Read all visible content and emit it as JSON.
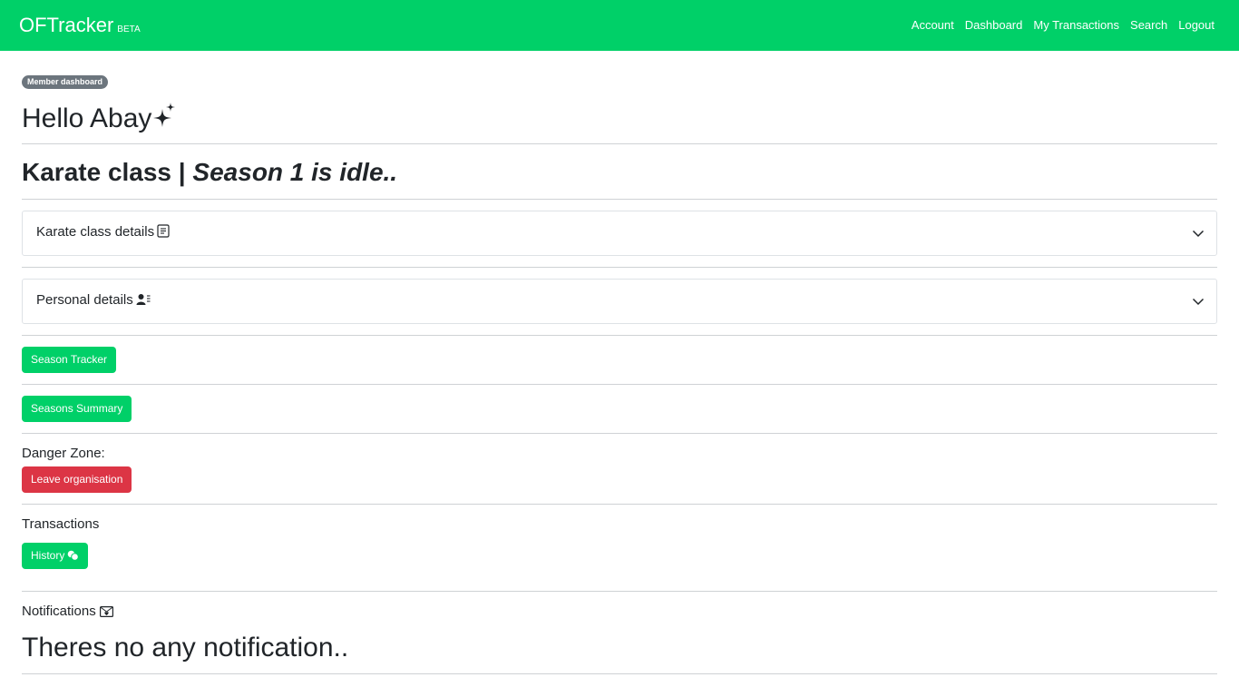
{
  "brand": {
    "name": "OFTracker",
    "badge": "BETA"
  },
  "nav": [
    "Account",
    "Dashboard",
    "My Transactions",
    "Search",
    "Logout"
  ],
  "dashboard": {
    "badge": "Member dashboard",
    "greeting": "Hello Abay",
    "greeting_icon": "sparkles-icon",
    "org_name": "Karate class",
    "separator": "|",
    "season_status": "Season 1 is idle.."
  },
  "accordions": [
    {
      "label": "Karate class details",
      "icon": "document-icon"
    },
    {
      "label": "Personal details",
      "icon": "person-lines-icon"
    }
  ],
  "buttons": {
    "season_tracker": "Season Tracker",
    "seasons_summary": "Seasons Summary",
    "leave_org": "Leave organisation",
    "history": "History"
  },
  "sections": {
    "danger_zone": "Danger Zone:",
    "transactions": "Transactions",
    "notifications": "Notifications"
  },
  "notifications": {
    "empty_message": "Theres no any notification.."
  },
  "colors": {
    "primary": "#00d068",
    "danger": "#dc3545",
    "badge": "#6c757d"
  }
}
